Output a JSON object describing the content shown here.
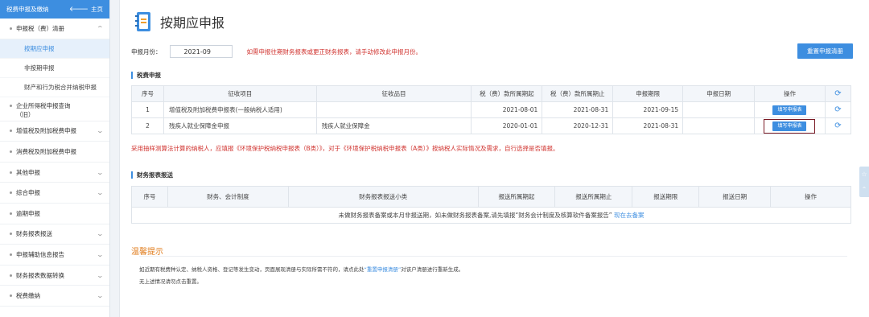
{
  "sidebar": {
    "header": {
      "title": "税费申报及缴纳",
      "home_label": "主页"
    },
    "items": [
      {
        "label": "申报税（费）清册",
        "has_chevron": true
      },
      {
        "label": "企业所得税申报查询（旧）",
        "line1": "企业所得税申报查询",
        "line2": "（旧）",
        "has_chevron": false
      },
      {
        "label": "增值税及附加税费申报",
        "has_chevron": true
      },
      {
        "label": "消费税及附加税费申报",
        "has_chevron": false
      },
      {
        "label": "其他申报",
        "has_chevron": true
      },
      {
        "label": "综合申报",
        "has_chevron": true
      },
      {
        "label": "逾期申报",
        "has_chevron": false
      },
      {
        "label": "财务报表报送",
        "has_chevron": true
      },
      {
        "label": "申报辅助信息报告",
        "has_chevron": true
      },
      {
        "label": "财务报表数据转换",
        "has_chevron": true
      },
      {
        "label": "税费缴纳",
        "has_chevron": true
      }
    ],
    "subitems": [
      {
        "label": "按期应申报",
        "active": true
      },
      {
        "label": "非按期申报",
        "active": false
      },
      {
        "label": "财产和行为税合并纳税申报",
        "active": false
      }
    ]
  },
  "main": {
    "title": "按期应申报",
    "period_label": "申报月份：",
    "period_value": "2021-09",
    "period_note": "如需申报往期财务报表或更正财务报表，请手动修改此申报月份。",
    "reset_button": "重置申报清册",
    "tax_section": {
      "title": "税费申报",
      "columns": [
        "序号",
        "征收项目",
        "征收品目",
        "税（费）款所属期起",
        "税（费）款所属期止",
        "申报期限",
        "申报日期",
        "操作"
      ],
      "rows": [
        {
          "no": "1",
          "item": "增值税及附加税费申报表(一般纳税人适用)",
          "subitem": "",
          "start": "2021-08-01",
          "end": "2021-08-31",
          "deadline": "2021-09-15",
          "date": "",
          "action": "填写申报表"
        },
        {
          "no": "2",
          "item": "残疾人就业保障金申报",
          "subitem": "残疾人就业保障金",
          "start": "2020-01-01",
          "end": "2020-12-31",
          "deadline": "2021-08-31",
          "date": "",
          "action": "填写申报表"
        }
      ]
    },
    "env_note": "采用抽样测算法计算的纳税人，应填报《环境保护税纳税申报表（B类）》，对于《环境保护税纳税申报表（A类）》按纳税人实际情况及需求，自行选择是否填报。",
    "fs_section": {
      "title": "财务报表报送",
      "columns": [
        "序号",
        "财务、会计制度",
        "财务报表报送小类",
        "报送所属期起",
        "报送所属期止",
        "报送期限",
        "报送日期",
        "操作"
      ],
      "empty_note": "未做财务报表备案或本月非报送期，如未做财务报表备案,请先填报“财务会计制度及核算软件备案报告”",
      "empty_link": "现在去备案"
    },
    "tips": {
      "title": "温馨提示",
      "line1_pre": "如近期有税费种认定、纳税人资格、登记等发生变动，页面展现清册与实际所需不符的，请点此处",
      "line1_link": "“重置申报清册”",
      "line1_post": "对该户清册进行重新生成。",
      "line2": "无上述情况请勿点击重置。"
    }
  },
  "colors": {
    "primary": "#3d8ee0",
    "warning": "#d0332f",
    "tip": "#e07b1a",
    "highlight_border": "#7a1a24"
  }
}
